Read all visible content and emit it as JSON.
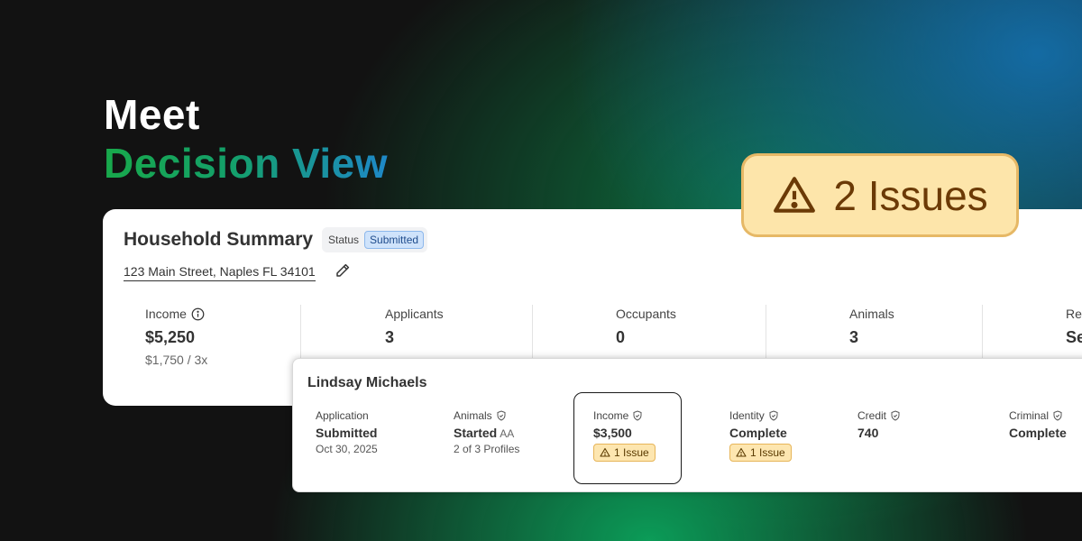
{
  "hero": {
    "line1": "Meet",
    "line2": "Decision View"
  },
  "household": {
    "title": "Household Summary",
    "status_label": "Status",
    "status_value": "Submitted",
    "address": "123 Main Street, Naples FL 34101",
    "stats": [
      {
        "label": "Income",
        "value": "$5,250",
        "sub": "$1,750 / 3x"
      },
      {
        "label": "Applicants",
        "value": "3"
      },
      {
        "label": "Occupants",
        "value": "0"
      },
      {
        "label": "Animals",
        "value": "3"
      },
      {
        "label": "Re",
        "value": "Se"
      }
    ]
  },
  "applicant": {
    "name": "Lindsay Michaels",
    "columns": [
      {
        "label": "Application",
        "value": "Submitted",
        "sub": "Oct 30, 2025"
      },
      {
        "label": "Animals",
        "value": "Started",
        "value_suffix": "AA",
        "sub": "2 of 3 Profiles"
      },
      {
        "label": "Income",
        "value": "$3,500",
        "issue": "1 Issue"
      },
      {
        "label": "Identity",
        "value": "Complete",
        "issue": "1 Issue"
      },
      {
        "label": "Credit",
        "value": "740"
      },
      {
        "label": "Criminal",
        "value": "Complete"
      }
    ]
  },
  "issues_badge": {
    "text": "2 Issues"
  },
  "colors": {
    "accent_green": "#18a84b",
    "accent_blue": "#1e88c8",
    "warning_bg": "#fde5aa",
    "warning_text": "#6b3a06",
    "status_badge_bg": "#cfe3fb"
  },
  "icons": [
    "info-icon",
    "pencil-icon",
    "shield-check-icon",
    "warning-icon"
  ]
}
